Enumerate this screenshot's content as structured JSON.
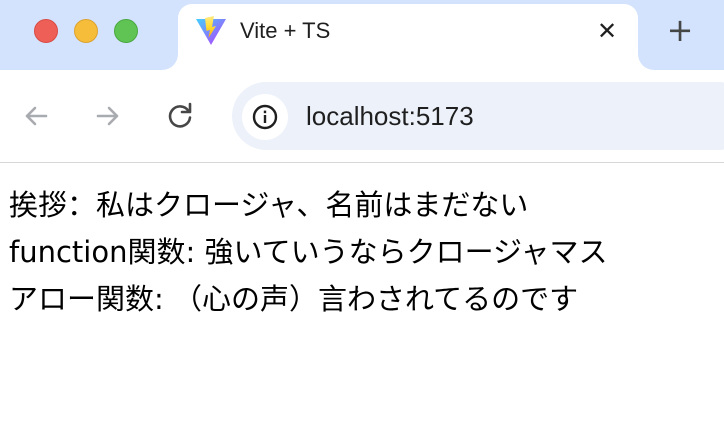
{
  "browser": {
    "tab": {
      "title": "Vite + TS",
      "favicon": "vite-logo-icon",
      "close_glyph": "✕"
    },
    "new_tab_glyph": "+",
    "address_bar": {
      "url": "localhost:5173"
    },
    "colors": {
      "tabstrip": "#d3e3fd",
      "omnibox": "#edf2fa",
      "close_light": "#ee5f57",
      "minimize_light": "#f6bd3b",
      "maximize_light": "#5fc454"
    }
  },
  "page": {
    "lines": [
      "挨拶：私はクロージャ、名前はまだない",
      "function関数: 強いていうならクロージャマス",
      "アロー関数: （心の声）言わされてるのです"
    ]
  }
}
